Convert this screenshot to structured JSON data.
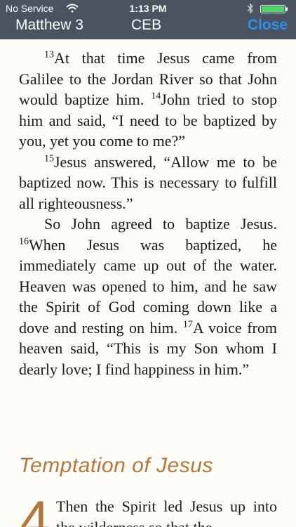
{
  "status_bar": {
    "carrier": "No Service",
    "time": "1:13 PM"
  },
  "nav": {
    "reference": "Matthew 3",
    "translation": "CEB",
    "close_label": "Close"
  },
  "passage": {
    "paragraphs": [
      {
        "segments": [
          {
            "verse": "13",
            "text": "At that time Jesus came from Galilee to the Jordan River so that John would baptize him. "
          },
          {
            "verse": "14",
            "text": "John tried to stop him and said, “I need to be baptized by you, yet you come to me?”"
          }
        ]
      },
      {
        "segments": [
          {
            "verse": "15",
            "text": "Jesus answered, “Allow me to be baptized now. This is necessary to fulfill all righteousness.”"
          }
        ]
      },
      {
        "segments": [
          {
            "verse": "",
            "text": "So John agreed to baptize Jesus. "
          },
          {
            "verse": "16",
            "text": "When Jesus was baptized, he immediately came up out of the water. Heaven was opened to him, and he saw the Spirit of God coming down like a dove and resting on him. "
          },
          {
            "verse": "17",
            "text": "A voice from heaven said, “This is my Son whom I dearly love; I find happiness in him.”"
          }
        ]
      }
    ]
  },
  "section": {
    "heading": "Temptation of Jesus",
    "chapter_number": "4",
    "text": "Then the Spirit led Jesus up into the wilderness so that the"
  },
  "colors": {
    "header_bg": "#4a5360",
    "accent": "#b4783f",
    "close": "#2f8ff3",
    "battery": "#4cd964"
  }
}
